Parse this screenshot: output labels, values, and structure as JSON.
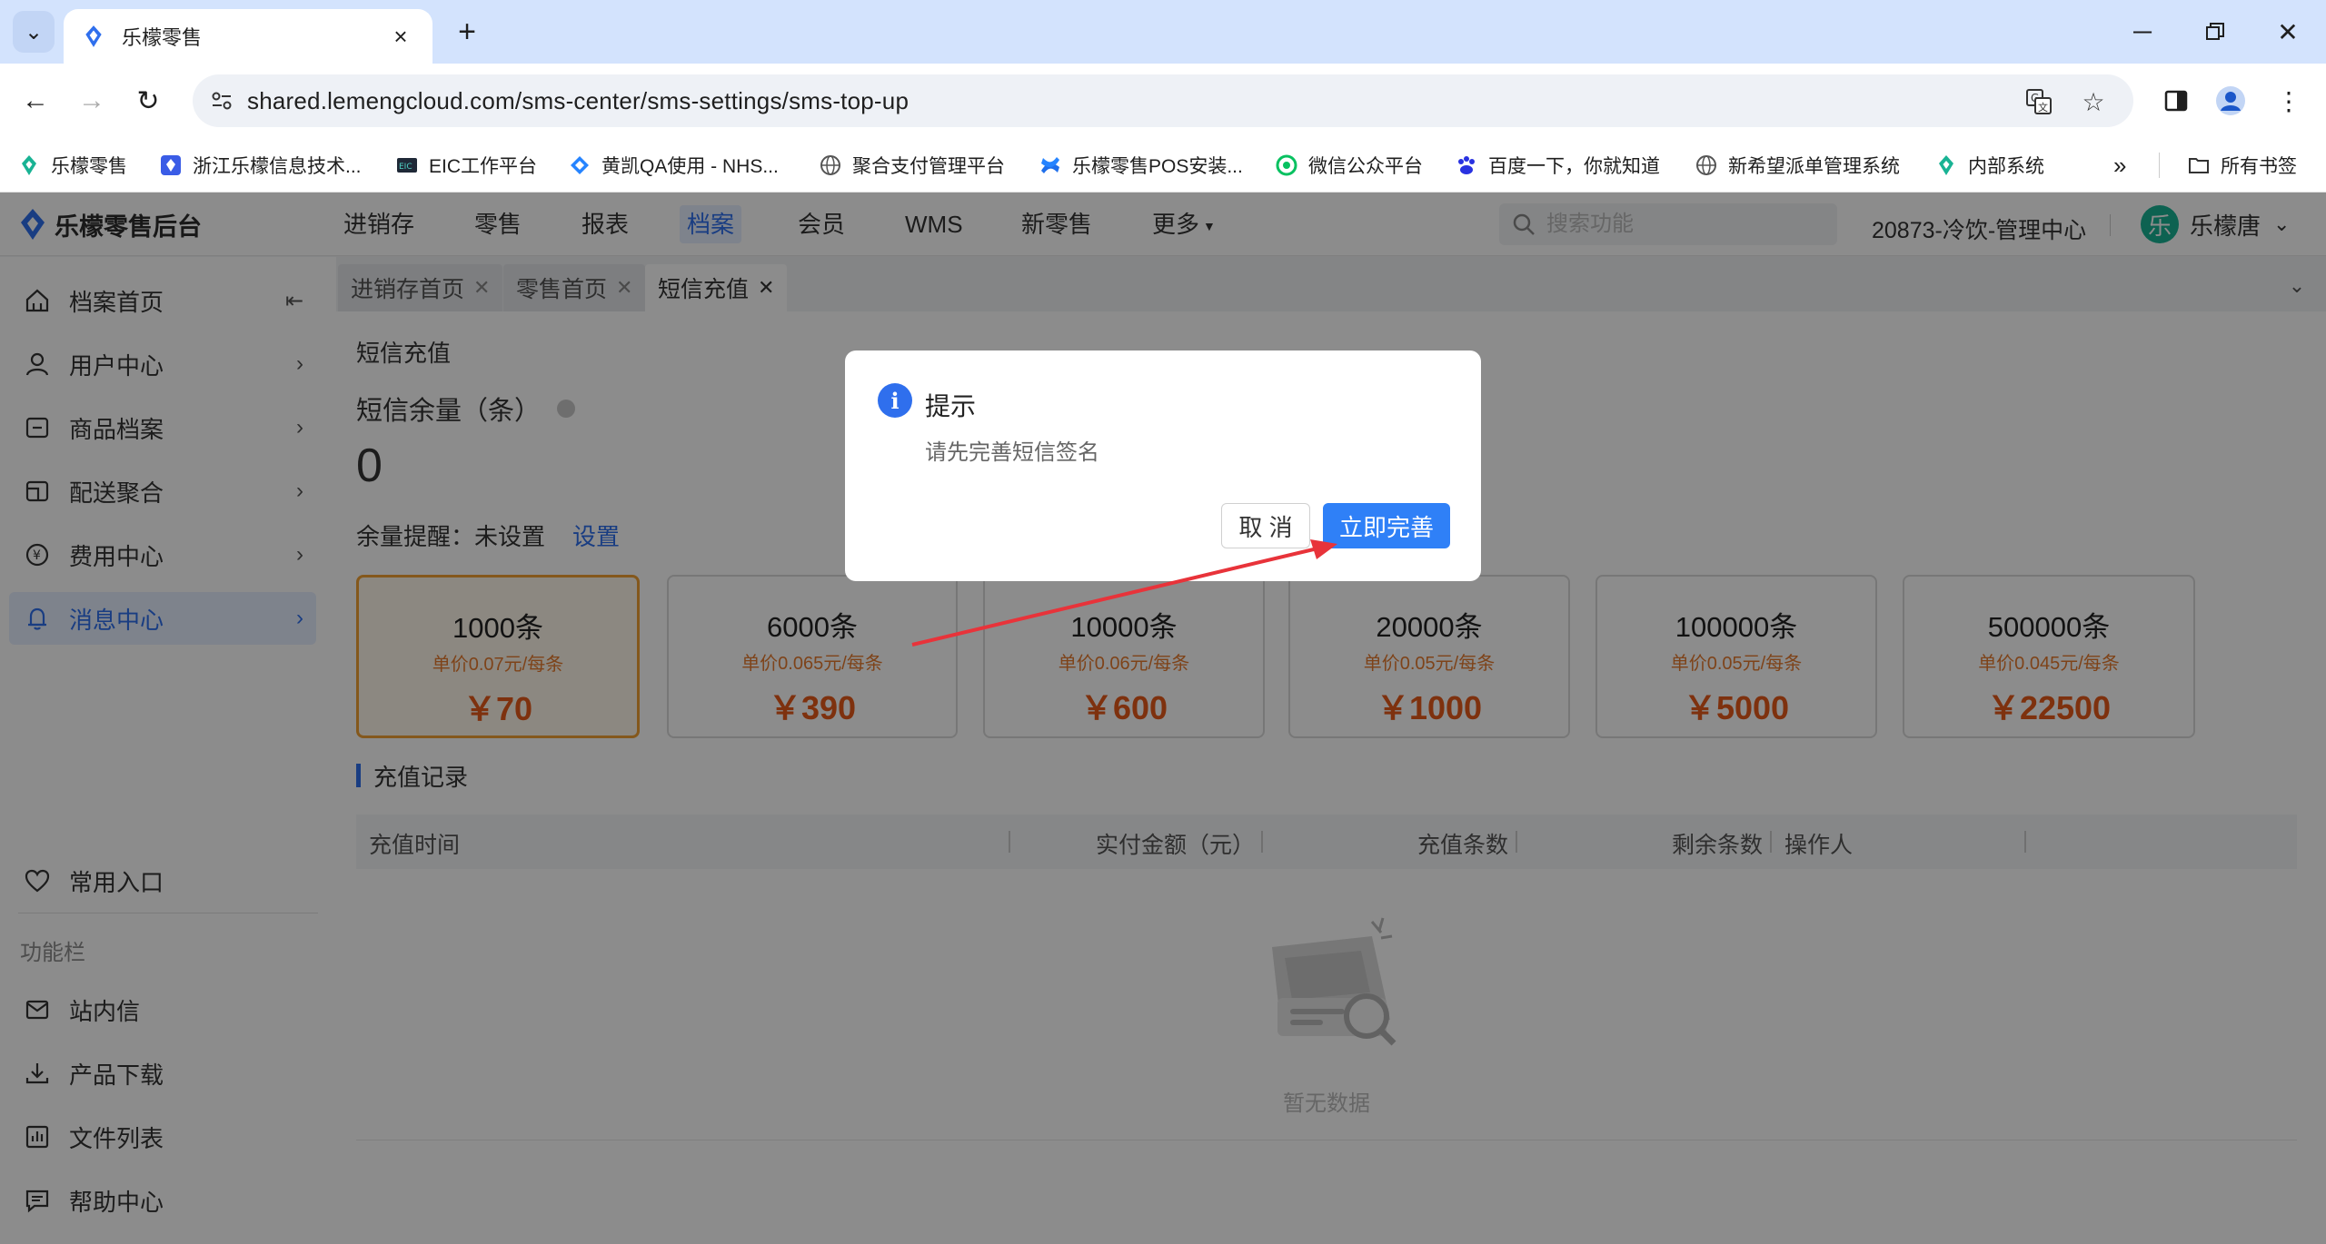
{
  "browser": {
    "tab_title": "乐檬零售",
    "url": "shared.lemengcloud.com/sms-center/sms-settings/sms-top-up",
    "bookmarks": [
      {
        "label": "乐檬零售",
        "icon": "lemeng-icon"
      },
      {
        "label": "浙江乐檬信息技术...",
        "icon": "zhejiang-lemeng-icon"
      },
      {
        "label": "EIC工作平台",
        "icon": "eic-icon"
      },
      {
        "label": "黄凯QA使用 - NHS...",
        "icon": "jira-icon"
      },
      {
        "label": "聚合支付管理平台",
        "icon": "globe-icon"
      },
      {
        "label": "乐檬零售POS安装...",
        "icon": "confluence-icon"
      },
      {
        "label": "微信公众平台",
        "icon": "wechat-icon"
      },
      {
        "label": "百度一下，你就知道",
        "icon": "baidu-icon"
      },
      {
        "label": "新希望派单管理系统",
        "icon": "globe-icon"
      },
      {
        "label": "内部系统",
        "icon": "lemeng-icon"
      }
    ],
    "all_bookmarks": "所有书签"
  },
  "app": {
    "logo_text": "乐檬零售后台",
    "nav": [
      "进销存",
      "零售",
      "报表",
      "档案",
      "会员",
      "WMS",
      "新零售",
      "更多"
    ],
    "active_nav": "档案",
    "search_placeholder": "搜索功能",
    "org_name": "20873-冷饮-管理中心",
    "avatar_char": "乐",
    "user_name": "乐檬唐"
  },
  "sidebar": {
    "items": [
      {
        "label": "档案首页",
        "icon": "home-icon"
      },
      {
        "label": "用户中心",
        "icon": "user-icon"
      },
      {
        "label": "商品档案",
        "icon": "box-icon"
      },
      {
        "label": "配送聚合",
        "icon": "delivery-icon"
      },
      {
        "label": "费用中心",
        "icon": "yen-icon"
      },
      {
        "label": "消息中心",
        "icon": "bell-icon"
      }
    ],
    "fav_label": "常用入口",
    "section_label": "功能栏",
    "tools": [
      {
        "label": "站内信",
        "icon": "mail-icon"
      },
      {
        "label": "产品下载",
        "icon": "download-icon"
      },
      {
        "label": "文件列表",
        "icon": "chart-icon"
      },
      {
        "label": "帮助中心",
        "icon": "help-icon"
      }
    ]
  },
  "page_tabs": [
    "进销存首页",
    "零售首页",
    "短信充值"
  ],
  "content": {
    "title": "短信充值",
    "balance_label": "短信余量（条）",
    "balance_value": "0",
    "remind_label": "余量提醒：未设置",
    "remind_link": "设置",
    "packages": [
      {
        "count": "1000条",
        "unit": "单价0.07元/每条",
        "price": "￥70"
      },
      {
        "count": "6000条",
        "unit": "单价0.065元/每条",
        "price": "￥390"
      },
      {
        "count": "10000条",
        "unit": "单价0.06元/每条",
        "price": "￥600"
      },
      {
        "count": "20000条",
        "unit": "单价0.05元/每条",
        "price": "￥1000"
      },
      {
        "count": "100000条",
        "unit": "单价0.05元/每条",
        "price": "￥5000"
      },
      {
        "count": "500000条",
        "unit": "单价0.045元/每条",
        "price": "￥22500"
      }
    ],
    "records_title": "充值记录",
    "columns": [
      "充值时间",
      "实付金额（元）",
      "充值条数",
      "剩余条数",
      "操作人"
    ],
    "empty_text": "暂无数据"
  },
  "dialog": {
    "title": "提示",
    "message": "请先完善短信签名",
    "cancel": "取 消",
    "ok": "立即完善"
  },
  "colors": {
    "primary": "#2f6fed",
    "selected_border": "#f0a033",
    "price": "#e65a1a",
    "annotation_arrow": "#e8333a"
  }
}
